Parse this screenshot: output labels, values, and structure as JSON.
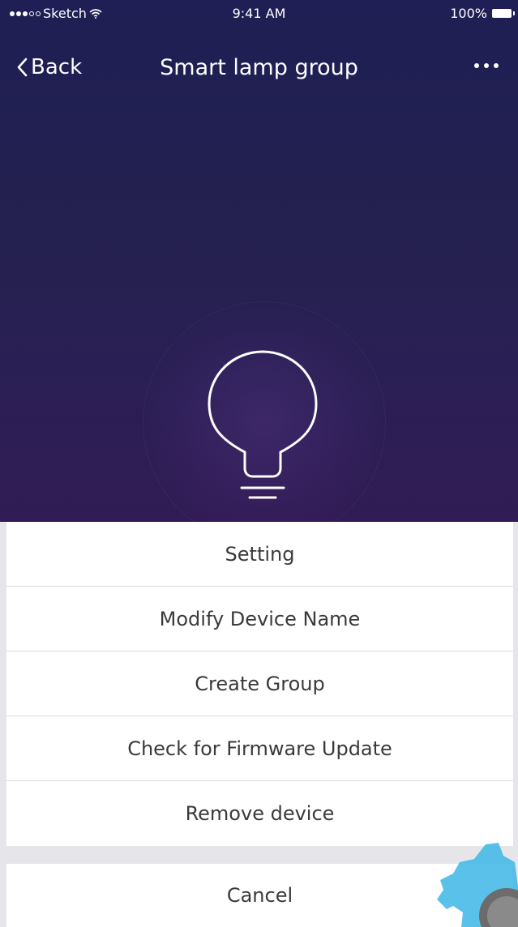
{
  "status_bar": {
    "carrier": "Sketch",
    "time": "9:41 AM",
    "battery": "100%"
  },
  "nav": {
    "back_label": "Back",
    "title": "Smart lamp group",
    "more_icon": "more-dots-icon"
  },
  "device": {
    "icon": "lightbulb-icon"
  },
  "action_sheet": {
    "items": [
      {
        "label": "Setting"
      },
      {
        "label": "Modify Device Name"
      },
      {
        "label": "Create Group"
      },
      {
        "label": "Check for Firmware Update"
      },
      {
        "label": "Remove device"
      }
    ],
    "cancel_label": "Cancel"
  },
  "colors": {
    "hero_top": "#1f1f55",
    "hero_bottom": "#311c55",
    "sheet_bg": "#ffffff",
    "separator": "#dcdce0",
    "text": "#3a3a3a",
    "watermark": "#3db6e8"
  }
}
